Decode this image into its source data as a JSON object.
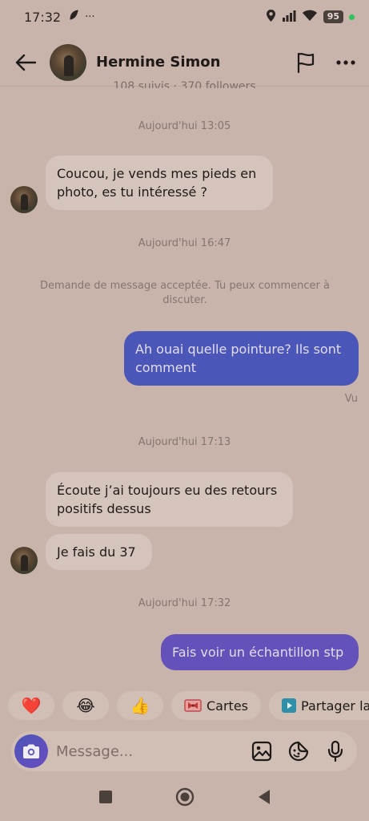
{
  "status_bar": {
    "time": "17:32",
    "overflow": "···",
    "battery": "95"
  },
  "header": {
    "contact_name": "Hermine Simon",
    "followers_line": "108 suivis · 370 followers"
  },
  "conversation": {
    "items": [
      {
        "type": "timestamp",
        "text": "Aujourd'hui 13:05"
      },
      {
        "type": "incoming",
        "text": "Coucou, je vends mes pieds en photo, es tu intéressé ?"
      },
      {
        "type": "timestamp",
        "text": "Aujourd'hui 16:47"
      },
      {
        "type": "notice",
        "text": "Demande de message acceptée. Tu peux commencer à discuter."
      },
      {
        "type": "outgoing",
        "text": "Ah ouai quelle pointure? Ils sont comment"
      },
      {
        "type": "seen",
        "text": "Vu"
      },
      {
        "type": "timestamp",
        "text": "Aujourd'hui 17:13"
      },
      {
        "type": "incoming",
        "text": "Écoute j’ai toujours eu des retours positifs dessus"
      },
      {
        "type": "incoming",
        "text": "Je fais du 37"
      },
      {
        "type": "timestamp",
        "text": "Aujourd'hui 17:32"
      },
      {
        "type": "outgoing",
        "text": "Fais voir un échantillon stp"
      }
    ]
  },
  "quick_replies": [
    {
      "icon": "heart-emoji",
      "glyph": "❤️"
    },
    {
      "icon": "laughing-emoji",
      "glyph": "😂"
    },
    {
      "icon": "thumbs-up-emoji",
      "glyph": "👍"
    },
    {
      "icon": "gift-icon",
      "label": "Cartes"
    },
    {
      "icon": "play-icon",
      "label": "Partager la p"
    }
  ],
  "composer": {
    "placeholder": "Message..."
  },
  "colors": {
    "background": "#c8b4ab",
    "incoming_bubble": "#d5c4bc",
    "outgoing_bubble": "#4a56b8",
    "outgoing_bubble_latest": "#6451b9"
  }
}
